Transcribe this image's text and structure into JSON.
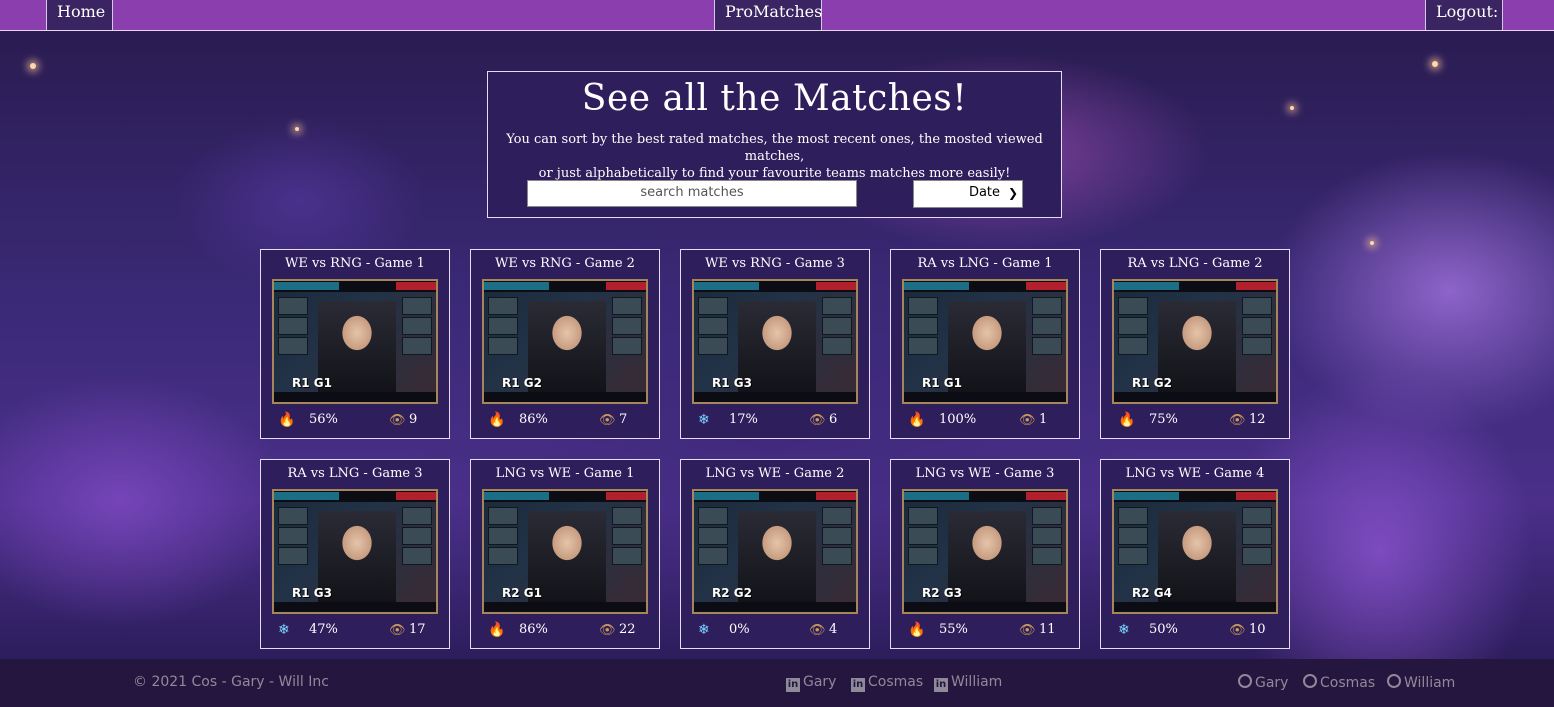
{
  "nav": {
    "home_label": "Home",
    "brand_label": "ProMatches",
    "logout_label": "Logout:"
  },
  "header": {
    "title": "See all the Matches!",
    "description_line1": "You can sort by the best rated matches, the most recent ones, the mosted viewed matches,",
    "description_line2": "or just alphabetically to find your favourite teams matches more easily!",
    "search_placeholder": "search matches",
    "sort_selected": "Date"
  },
  "matches": [
    {
      "title": "WE vs RNG - Game 1",
      "tag": "R1 G1",
      "rating": "56%",
      "rating_icon": "fire-icon",
      "views": "9"
    },
    {
      "title": "WE vs RNG - Game 2",
      "tag": "R1 G2",
      "rating": "86%",
      "rating_icon": "fire-icon",
      "views": "7"
    },
    {
      "title": "WE vs RNG - Game 3",
      "tag": "R1 G3",
      "rating": "17%",
      "rating_icon": "snowflake-icon",
      "views": "6"
    },
    {
      "title": "RA vs LNG - Game 1",
      "tag": "R1 G1",
      "rating": "100%",
      "rating_icon": "fire-icon",
      "views": "1"
    },
    {
      "title": "RA vs LNG - Game 2",
      "tag": "R1 G2",
      "rating": "75%",
      "rating_icon": "fire-icon",
      "views": "12"
    },
    {
      "title": "RA vs LNG - Game 3",
      "tag": "R1 G3",
      "rating": "47%",
      "rating_icon": "snowflake-icon",
      "views": "17"
    },
    {
      "title": "LNG vs WE - Game 1",
      "tag": "R2 G1",
      "rating": "86%",
      "rating_icon": "fire-icon",
      "views": "22"
    },
    {
      "title": "LNG vs WE - Game 2",
      "tag": "R2 G2",
      "rating": "0%",
      "rating_icon": "snowflake-icon",
      "views": "4"
    },
    {
      "title": "LNG vs WE - Game 3",
      "tag": "R2 G3",
      "rating": "55%",
      "rating_icon": "fire-icon",
      "views": "11"
    },
    {
      "title": "LNG vs WE - Game 4",
      "tag": "R2 G4",
      "rating": "50%",
      "rating_icon": "snowflake-icon",
      "views": "10"
    }
  ],
  "footer": {
    "copyright": "© 2021   Cos - Gary - Will Inc",
    "linkedin_links": [
      "Gary",
      "Cosmas",
      "William"
    ],
    "github_links": [
      "Gary",
      "Cosmas",
      "William"
    ]
  }
}
